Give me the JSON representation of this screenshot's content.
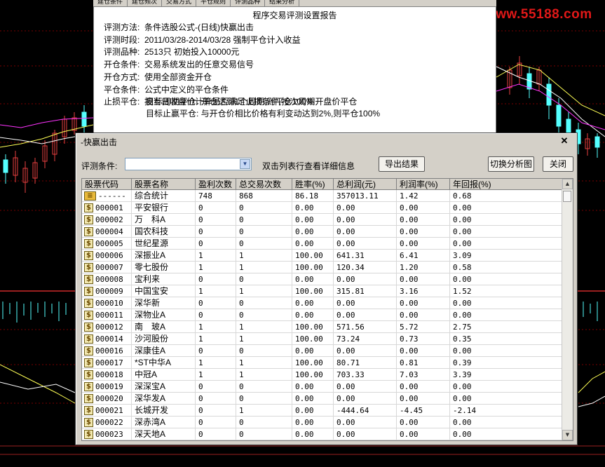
{
  "watermark": {
    "url": "www.55188.com"
  },
  "top_tabs": [
    "建仓条件",
    "建仓频次",
    "交易方式",
    "平仓规则",
    "评测品种",
    "结果分析"
  ],
  "report": {
    "title": "程序交易评测设置报告",
    "rows": [
      {
        "key": "评测方法:",
        "value": "条件选股公式-(日线)快赢出击"
      },
      {
        "key": "评测时段:",
        "value": "2011/03/28-2014/03/28 强制平仓计入收益"
      },
      {
        "key": "评测品种:",
        "value": "2513只 初始投入10000元"
      },
      {
        "key": "开仓条件:",
        "value": "交易系统发出的任意交易信号"
      },
      {
        "key": "开仓方式:",
        "value": "使用全部资金开仓"
      },
      {
        "key": "平仓条件:",
        "value": "公式中定义的平仓条件"
      },
      {
        "key": "止损平仓:",
        "value": "按当日收盘价计算是否满足止损条件,按次周期开盘价平仓"
      }
    ],
    "sub_rows": [
      "目标周期平仓: 开仓达到1个周期,则平仓100%",
      "目标止赢平仓: 与开仓价相比价格有利变动达到2%,则平仓100%"
    ]
  },
  "dialog": {
    "title": "-快赢出击",
    "condition_label": "评测条件:",
    "condition_value": "",
    "hint": "双击列表行查看详细信息",
    "export_label": "导出结果",
    "switch_label": "切换分析图",
    "close_label": "关闭"
  },
  "table": {
    "headers": [
      "股票代码",
      "股票名称",
      "盈利次数",
      "总交易次数",
      "胜率(%)",
      "总利润(元)",
      "利润率(%)",
      "年回报(%)"
    ],
    "rows": [
      [
        "------",
        "综合统计",
        "748",
        "868",
        "86.18",
        "357013.11",
        "1.42",
        "0.68"
      ],
      [
        "000001",
        "平安银行",
        "0",
        "0",
        "0.00",
        "0.00",
        "0.00",
        "0.00"
      ],
      [
        "000002",
        "万　科A",
        "0",
        "0",
        "0.00",
        "0.00",
        "0.00",
        "0.00"
      ],
      [
        "000004",
        "国农科技",
        "0",
        "0",
        "0.00",
        "0.00",
        "0.00",
        "0.00"
      ],
      [
        "000005",
        "世纪星源",
        "0",
        "0",
        "0.00",
        "0.00",
        "0.00",
        "0.00"
      ],
      [
        "000006",
        "深振业A",
        "1",
        "1",
        "100.00",
        "641.31",
        "6.41",
        "3.09"
      ],
      [
        "000007",
        "零七股份",
        "1",
        "1",
        "100.00",
        "120.34",
        "1.20",
        "0.58"
      ],
      [
        "000008",
        "宝利来",
        "0",
        "0",
        "0.00",
        "0.00",
        "0.00",
        "0.00"
      ],
      [
        "000009",
        "中国宝安",
        "1",
        "1",
        "100.00",
        "315.81",
        "3.16",
        "1.52"
      ],
      [
        "000010",
        "深华新",
        "0",
        "0",
        "0.00",
        "0.00",
        "0.00",
        "0.00"
      ],
      [
        "000011",
        "深物业A",
        "0",
        "0",
        "0.00",
        "0.00",
        "0.00",
        "0.00"
      ],
      [
        "000012",
        "南　玻A",
        "1",
        "1",
        "100.00",
        "571.56",
        "5.72",
        "2.75"
      ],
      [
        "000014",
        "沙河股份",
        "1",
        "1",
        "100.00",
        "73.24",
        "0.73",
        "0.35"
      ],
      [
        "000016",
        "深康佳A",
        "0",
        "0",
        "0.00",
        "0.00",
        "0.00",
        "0.00"
      ],
      [
        "000017",
        "*ST中华A",
        "1",
        "1",
        "100.00",
        "80.71",
        "0.81",
        "0.39"
      ],
      [
        "000018",
        "中冠A",
        "1",
        "1",
        "100.00",
        "703.33",
        "7.03",
        "3.39"
      ],
      [
        "000019",
        "深深宝A",
        "0",
        "0",
        "0.00",
        "0.00",
        "0.00",
        "0.00"
      ],
      [
        "000020",
        "深华发A",
        "0",
        "0",
        "0.00",
        "0.00",
        "0.00",
        "0.00"
      ],
      [
        "000021",
        "长城开发",
        "0",
        "1",
        "0.00",
        "-444.64",
        "-4.45",
        "-2.14"
      ],
      [
        "000022",
        "深赤湾A",
        "0",
        "0",
        "0.00",
        "0.00",
        "0.00",
        "0.00"
      ],
      [
        "000023",
        "深天地A",
        "0",
        "0",
        "0.00",
        "0.00",
        "0.00",
        "0.00"
      ]
    ]
  },
  "icons": {
    "summary": "summary-icon",
    "stock": "stock-icon",
    "close": "close-icon",
    "dropdown": "chevron-down-icon"
  },
  "colors": {
    "background": "#000000",
    "dialog": "#d4d0c8",
    "watermark": "#e01818"
  }
}
